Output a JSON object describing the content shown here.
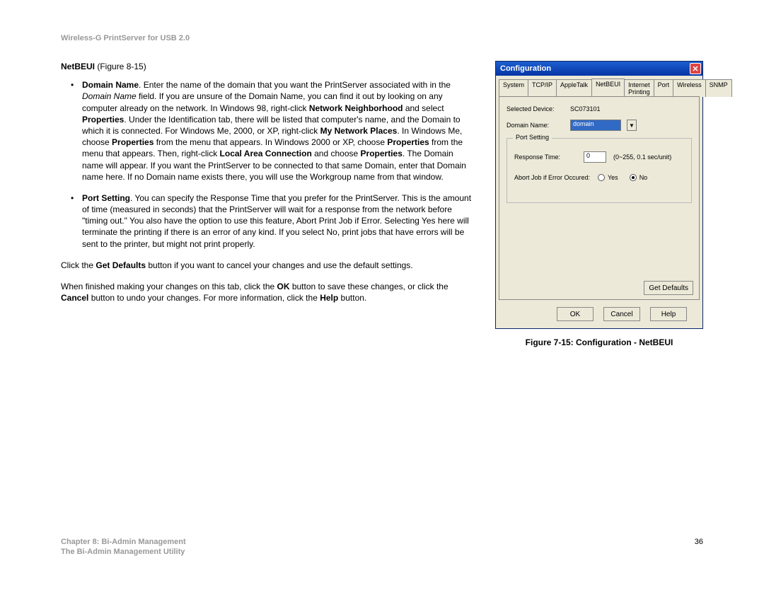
{
  "header": "Wireless-G PrintServer for USB 2.0",
  "section": {
    "bold": "NetBEUI",
    "rest": " (Figure 8-15)"
  },
  "bullet1": {
    "b1": "Domain Name",
    "t1": ". Enter the name of the domain that you want the PrintServer associated with in the ",
    "i1": "Domain Name",
    "t2": " field. If you are unsure of the Domain Name, you can find it out by looking on any computer already on the network. In Windows 98, right-click ",
    "b2": "Network Neighborhood",
    "t3": " and select ",
    "b3": "Properties",
    "t4": ". Under the Identification tab, there will be listed that computer's name, and the Domain to which it is connected. For Windows Me, 2000, or XP, right-click ",
    "b4": "My Network Places",
    "t5": ". In Windows Me, choose ",
    "b5": "Properties",
    "t6": " from the menu that appears. In Windows 2000 or XP, choose ",
    "b6": "Properties",
    "t7": " from the menu that appears. Then, right-click ",
    "b7": "Local Area Connection",
    "t8": " and choose ",
    "b8": "Properties",
    "t9": ". The Domain name will appear. If you want the PrintServer to be connected to that same Domain, enter that Domain name here. If no Domain name exists there, you will use the Workgroup name from that window."
  },
  "bullet2": {
    "b1": "Port Setting",
    "t1": ". You can specify the Response Time that you prefer for the PrintServer. This is the amount of time (measured in seconds) that the PrintServer will wait for a response from the network before \"timing out.\" You also have the option to use this feature, Abort Print Job if Error. Selecting Yes here will terminate the printing if there is an error of any kind. If you select No, print jobs that have errors will be sent to the printer, but might not print properly."
  },
  "para1": {
    "t1": "Click the ",
    "b1": "Get Defaults",
    "t2": " button if you want to cancel your changes and use the default settings."
  },
  "para2": {
    "t1": "When finished making your changes on this tab, click the ",
    "b1": "OK",
    "t2": " button to save these changes, or click the ",
    "b2": "Cancel",
    "t3": " button to undo your changes. For more information, click the ",
    "b3": "Help",
    "t4": " button."
  },
  "dialog": {
    "title": "Configuration",
    "tabs": [
      "System",
      "TCP/IP",
      "AppleTalk",
      "NetBEUI",
      "Internet Printing",
      "Port",
      "Wireless",
      "SNMP"
    ],
    "active_tab": 3,
    "selected_device_label": "Selected Device:",
    "selected_device_value": "SC073101",
    "domain_label": "Domain Name:",
    "domain_value": "domain",
    "fieldset_title": "Port Setting",
    "response_label": "Response Time:",
    "response_value": "0",
    "response_hint": "(0~255, 0.1 sec/unit)",
    "abort_label": "Abort Job if Error Occured:",
    "radio_yes": "Yes",
    "radio_no": "No",
    "get_defaults": "Get Defaults",
    "ok": "OK",
    "cancel": "Cancel",
    "help": "Help"
  },
  "figure_caption": "Figure 7-15: Configuration - NetBEUI",
  "footer": {
    "chapter": "Chapter 8: Bi-Admin Management",
    "sub": "The Bi-Admin Management Utility",
    "page": "36"
  }
}
